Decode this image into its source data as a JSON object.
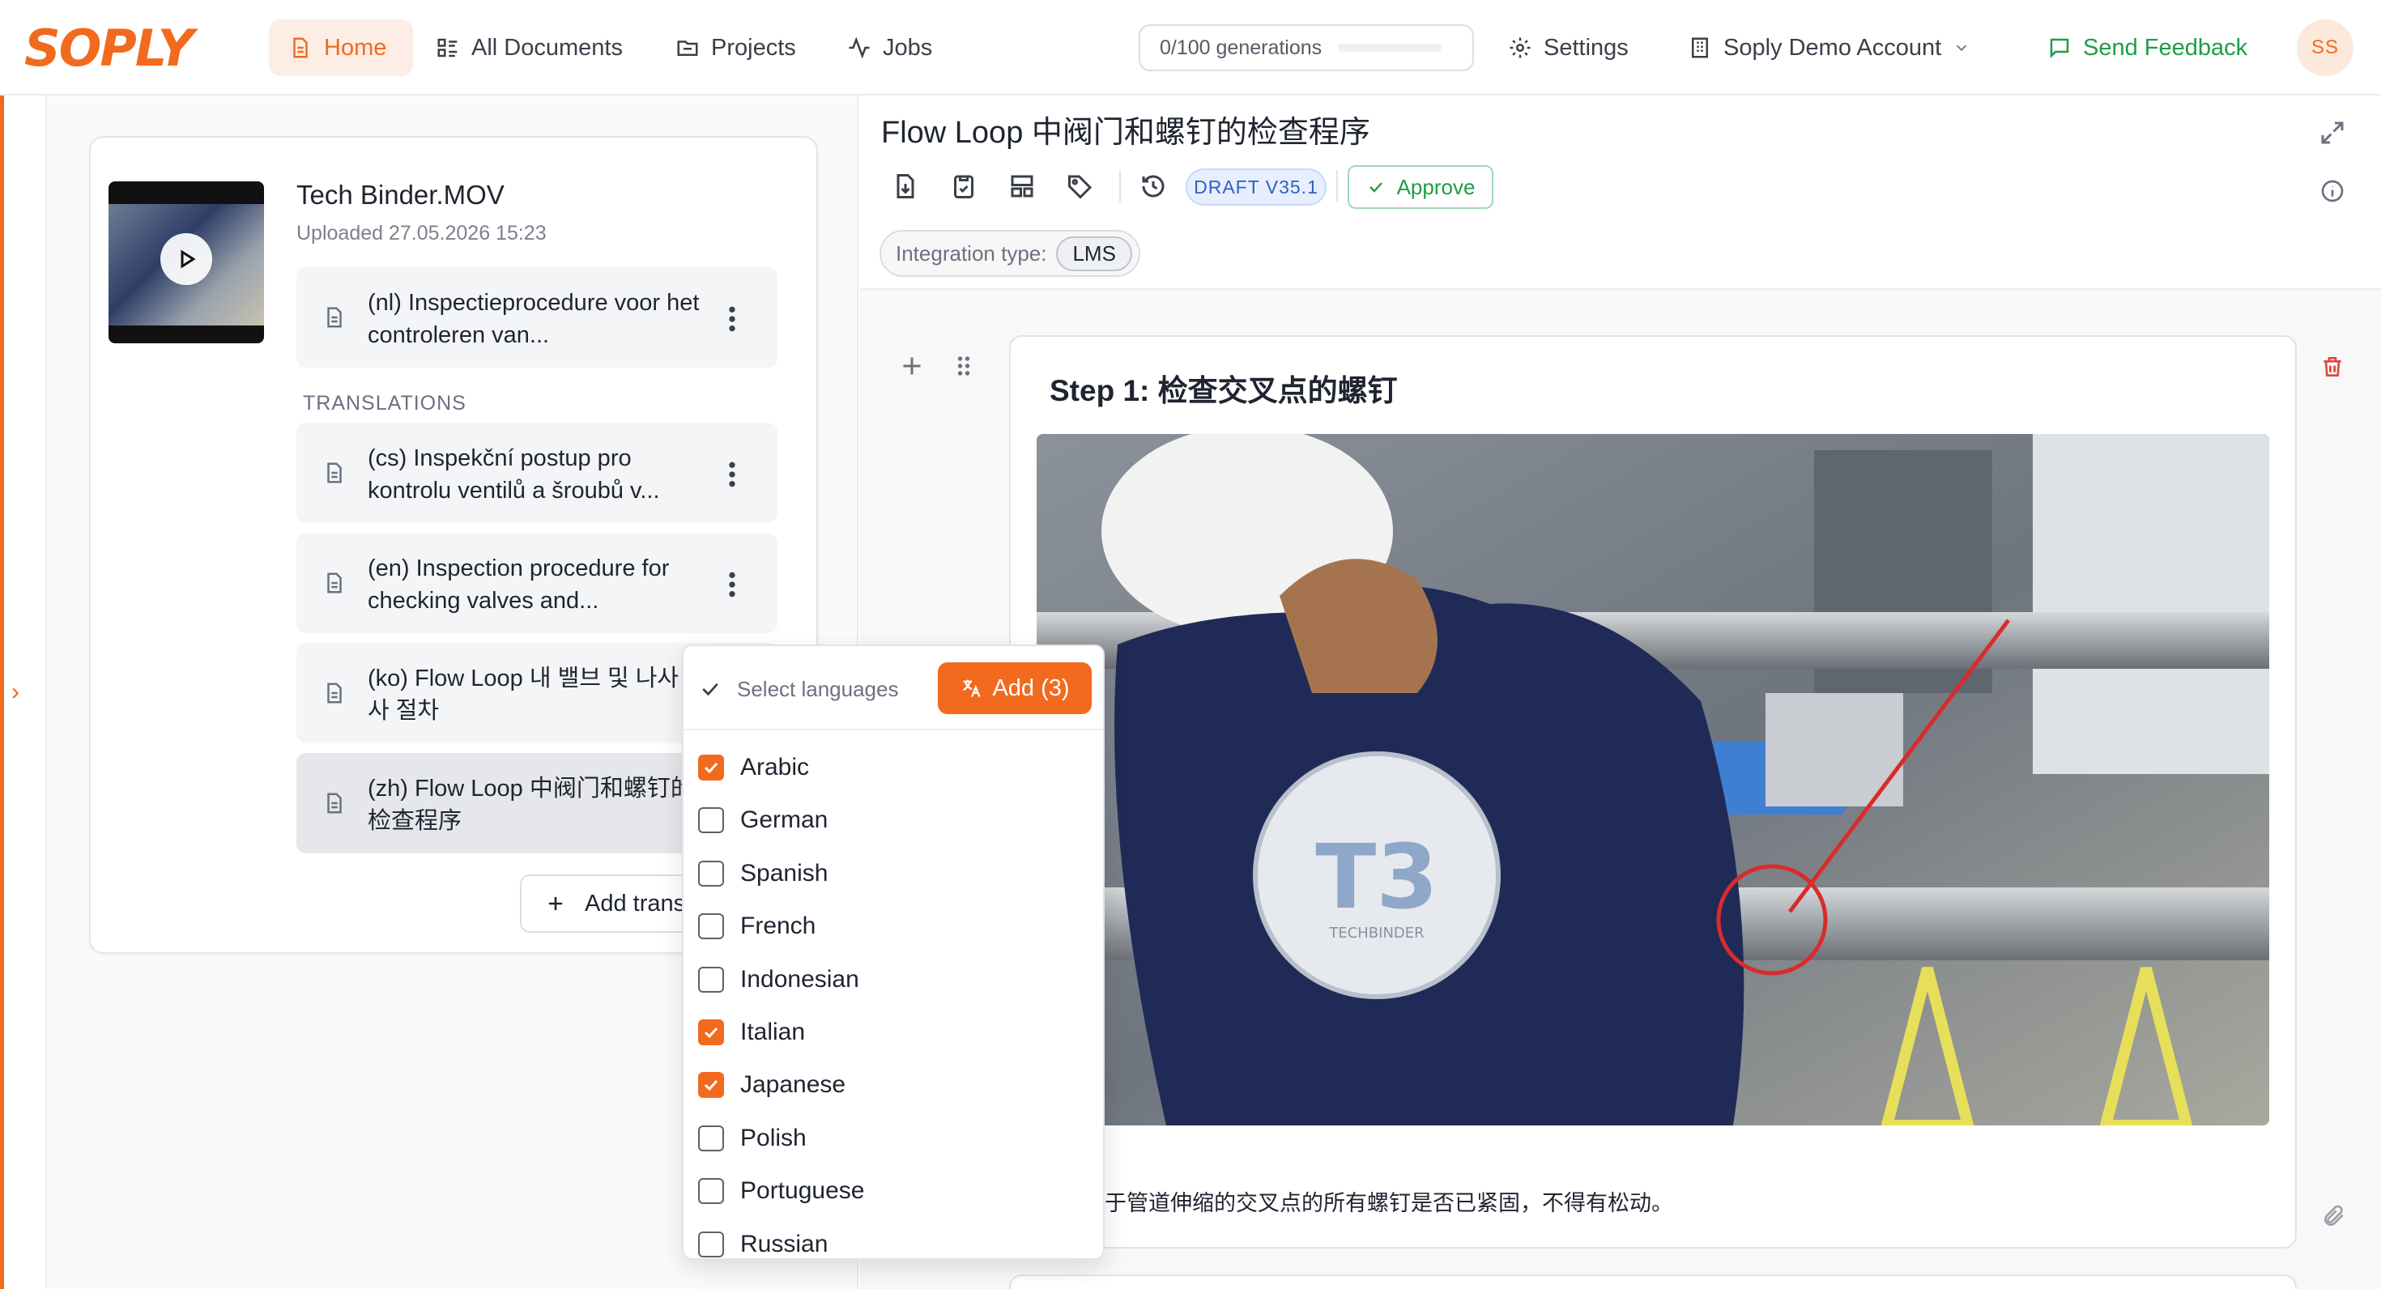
{
  "app": {
    "brand": "SOPLY",
    "accent": "#f26a1e",
    "success": "#1e9e45"
  },
  "nav": {
    "home": "Home",
    "all_documents": "All Documents",
    "projects": "Projects",
    "jobs": "Jobs",
    "settings": "Settings",
    "account": "Soply Demo Account",
    "feedback": "Send Feedback",
    "avatar_initials": "SS"
  },
  "generations": {
    "label": "0/100 generations",
    "used_fraction": 0
  },
  "left": {
    "file_title": "Tech Binder.MOV",
    "file_uploaded": "Uploaded 27.05.2026 15:23",
    "original": {
      "label": "(nl) Inspectieprocedure voor het controleren van..."
    },
    "translations_header": "TRANSLATIONS",
    "translations": [
      {
        "label": "(cs) Inspekční postup pro kontrolu ventilů a šroubů v..."
      },
      {
        "label": "(en) Inspection procedure for checking valves and..."
      },
      {
        "label": "(ko) Flow Loop 내 밸브 및 나사 검사 절차"
      },
      {
        "label": "(zh) Flow Loop 中阀门和螺钉的检查程序"
      }
    ],
    "add_translation": "Add trans"
  },
  "dropdown": {
    "select_label": "Select languages",
    "add_button": "Add (3)",
    "languages": [
      {
        "name": "Arabic",
        "checked": true
      },
      {
        "name": "German",
        "checked": false
      },
      {
        "name": "Spanish",
        "checked": false
      },
      {
        "name": "French",
        "checked": false
      },
      {
        "name": "Indonesian",
        "checked": false
      },
      {
        "name": "Italian",
        "checked": true
      },
      {
        "name": "Japanese",
        "checked": true
      },
      {
        "name": "Polish",
        "checked": false
      },
      {
        "name": "Portuguese",
        "checked": false
      },
      {
        "name": "Russian",
        "checked": false
      }
    ]
  },
  "editor": {
    "title": "Flow Loop 中阀门和螺钉的检查程序",
    "draft_badge": "DRAFT V35.1",
    "approve": "Approve",
    "integration_label": "Integration type:",
    "integration_value": "LMS",
    "step_title": "Step 1: 检查交叉点的螺钉",
    "step_text": "于管道伸缩的交叉点的所有螺钉是否已紧固，不得有松动。",
    "image_logo_text": "TECHBINDER"
  }
}
